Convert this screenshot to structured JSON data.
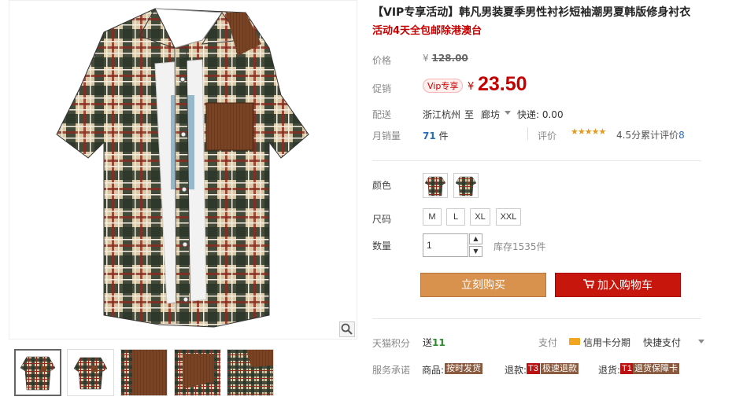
{
  "product": {
    "title": "【VIP专享活动】韩凡男装夏季男性衬衫短袖潮男夏韩版修身衬衣",
    "subtitle": "活动4天全包邮除港澳台"
  },
  "price": {
    "label": "价格",
    "currency": "¥",
    "original": "128.00",
    "promo_label": "促销",
    "vip_badge": "Vip专享",
    "promo": "23.50"
  },
  "shipping": {
    "label": "配送",
    "from": "浙江杭州",
    "to_word": "至",
    "to": "廊坊",
    "express": "快递: 0.00"
  },
  "sales": {
    "label": "月销量",
    "count": "71",
    "unit": "件",
    "review_label": "评价",
    "stars": "★★★★★",
    "rating_text": "4.5分累计评价",
    "rating_count": "8"
  },
  "color": {
    "label": "颜色"
  },
  "size": {
    "label": "尺码",
    "options": [
      "M",
      "L",
      "XL",
      "XXL"
    ]
  },
  "quantity": {
    "label": "数量",
    "value": "1",
    "stock": "库存1535件"
  },
  "actions": {
    "buy": "立刻购买",
    "cart": "加入购物车"
  },
  "points": {
    "label": "天猫积分",
    "value_prefix": "送",
    "value": "11",
    "pay_label": "支付",
    "credit": "信用卡分期",
    "quick_pay": "快捷支付"
  },
  "service": {
    "label": "服务承诺",
    "goods_label": "商品:",
    "goods_tag": "按时发货",
    "refund_label": "退款:",
    "refund_mark": "T3",
    "refund_tag": "极速退款",
    "return_label": "退货:",
    "return_mark": "T1",
    "return_tag": "退货保障卡"
  },
  "colors": {
    "accent_red": "#c40000",
    "buy_button": "#d9914e",
    "cart_button": "#c7160c",
    "link_blue": "#2b6bb8"
  },
  "icons": [
    "zoom-icon",
    "dropdown-icon",
    "stepper-up-icon",
    "stepper-down-icon",
    "cart-icon",
    "credit-card-icon"
  ]
}
